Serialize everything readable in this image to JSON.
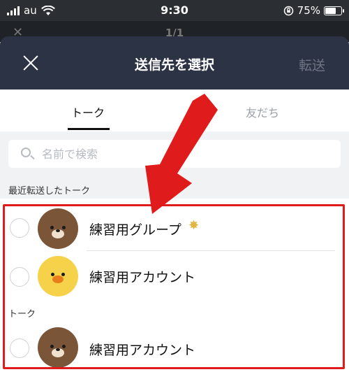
{
  "status_bar": {
    "carrier": "au",
    "time": "9:30",
    "battery_percent": "75%",
    "battery_level": 0.75
  },
  "behind": {
    "title": "1/1"
  },
  "header": {
    "title": "送信先を選択",
    "forward_label": "転送",
    "close_icon": "close-icon"
  },
  "tabs": [
    {
      "label": "トーク",
      "active": true
    },
    {
      "label": "友だち",
      "active": false
    }
  ],
  "search": {
    "placeholder": "名前で検索",
    "icon": "search-icon"
  },
  "sections": {
    "recent": "最近転送したトーク",
    "talk": "トーク"
  },
  "recent_items": [
    {
      "name": "練習用グループ",
      "avatar": "brown-bear-icon",
      "badge": "star-icon"
    },
    {
      "name": "練習用アカウント",
      "avatar": "sally-chick-icon"
    }
  ],
  "talk_items": [
    {
      "name": "練習用アカウント",
      "avatar": "brown-bear-icon"
    }
  ],
  "colors": {
    "header_bg": "#2c3345",
    "highlight": "#e01b1b",
    "arrow": "#e01b1b"
  }
}
